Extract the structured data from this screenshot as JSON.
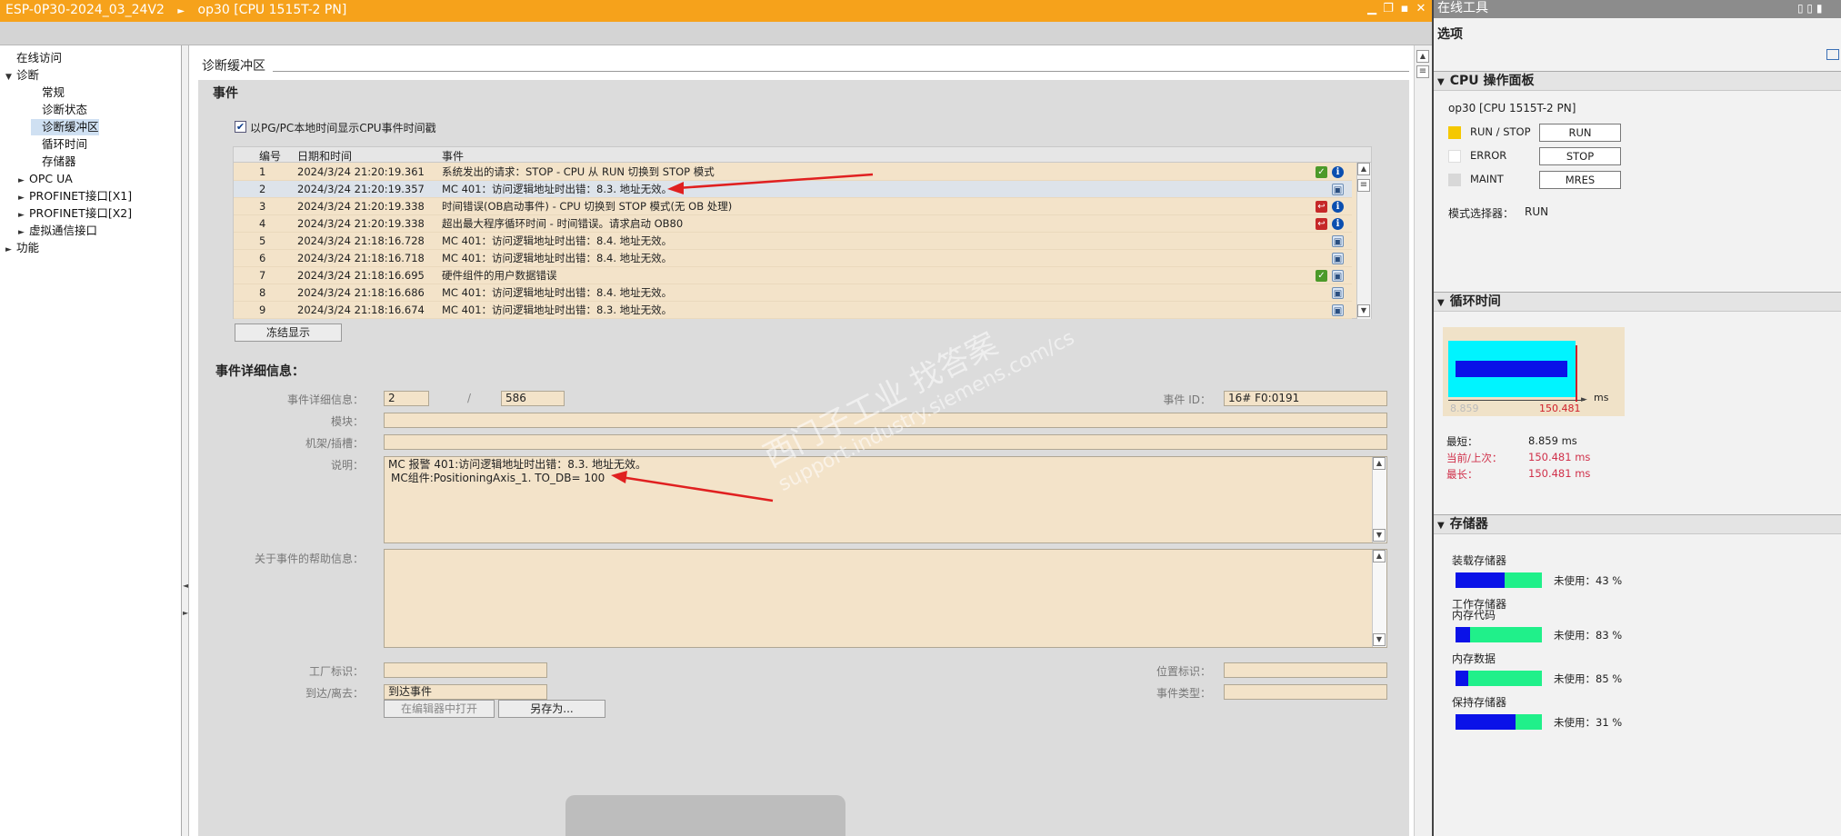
{
  "titlebar": {
    "project": "ESP-0P30-2024_03_24V2",
    "device": "op30 [CPU 1515T-2 PN]",
    "sep": "►"
  },
  "nav": {
    "items": [
      {
        "label": "在线访问",
        "indent": 0,
        "tri": ""
      },
      {
        "label": "诊断",
        "indent": 0,
        "tri": "▼"
      },
      {
        "label": "常规",
        "indent": 2,
        "tri": ""
      },
      {
        "label": "诊断状态",
        "indent": 2,
        "tri": ""
      },
      {
        "label": "诊断缓冲区",
        "indent": 2,
        "tri": "",
        "selected": true
      },
      {
        "label": "循环时间",
        "indent": 2,
        "tri": ""
      },
      {
        "label": "存储器",
        "indent": 2,
        "tri": ""
      },
      {
        "label": "OPC UA",
        "indent": 1,
        "tri": "►"
      },
      {
        "label": "PROFINET接口[X1]",
        "indent": 1,
        "tri": "►"
      },
      {
        "label": "PROFINET接口[X2]",
        "indent": 1,
        "tri": "►"
      },
      {
        "label": "虚拟通信接口",
        "indent": 1,
        "tri": "►"
      },
      {
        "label": "功能",
        "indent": 0,
        "tri": "►"
      }
    ]
  },
  "main": {
    "section_title": "诊断缓冲区",
    "events_title": "事件",
    "checkbox_label": "以PG/PC本地时间显示CPU事件时间戳",
    "columns": [
      "编号",
      "日期和时间",
      "事件"
    ],
    "rows": [
      {
        "no": "1",
        "time": "2024/3/24 21:20:19.361",
        "event": "系统发出的请求：STOP - CPU 从 RUN 切换到 STOP 模式",
        "icons": [
          "check",
          "info"
        ]
      },
      {
        "no": "2",
        "time": "2024/3/24 21:20:19.357",
        "event": "MC 401：访问逻辑地址时出错：8.3. 地址无效。",
        "icons": [
          "user"
        ],
        "selected": true
      },
      {
        "no": "3",
        "time": "2024/3/24 21:20:19.338",
        "event": "时间错误(OB启动事件) - CPU 切换到 STOP 模式(无 OB 处理)",
        "icons": [
          "error",
          "info"
        ]
      },
      {
        "no": "4",
        "time": "2024/3/24 21:20:19.338",
        "event": "超出最大程序循环时间 - 时间错误。请求启动 OB80",
        "icons": [
          "error",
          "info"
        ]
      },
      {
        "no": "5",
        "time": "2024/3/24 21:18:16.728",
        "event": "MC 401：访问逻辑地址时出错：8.4. 地址无效。",
        "icons": [
          "user"
        ]
      },
      {
        "no": "6",
        "time": "2024/3/24 21:18:16.718",
        "event": "MC 401：访问逻辑地址时出错：8.4. 地址无效。",
        "icons": [
          "user"
        ]
      },
      {
        "no": "7",
        "time": "2024/3/24 21:18:16.695",
        "event": "硬件组件的用户数据错误",
        "icons": [
          "check",
          "user"
        ]
      },
      {
        "no": "8",
        "time": "2024/3/24 21:18:16.686",
        "event": "MC 401：访问逻辑地址时出错：8.4. 地址无效。",
        "icons": [
          "user"
        ]
      },
      {
        "no": "9",
        "time": "2024/3/24 21:18:16.674",
        "event": "MC 401：访问逻辑地址时出错：8.3. 地址无效。",
        "icons": [
          "user"
        ]
      }
    ],
    "freeze_button": "冻结显示",
    "details_title": "事件详细信息：",
    "detail_label": "事件详细信息：",
    "detail_current": "2",
    "detail_slash": "/",
    "detail_total": "586",
    "event_id_label": "事件 ID：",
    "event_id": "16# F0:0191",
    "module_label": "模块：",
    "rack_label": "机架/插槽：",
    "desc_label": "说明：",
    "desc_line1": "MC 报警 401:访问逻辑地址时出错：8.3. 地址无效。",
    "desc_line2": "MC组件:PositioningAxis_1.  TO_DB=  100",
    "help_label": "关于事件的帮助信息：",
    "plant_label": "工厂标识：",
    "location_label": "位置标识：",
    "arrive_label": "到达/离去：",
    "arrive_value": "到达事件",
    "event_type_label": "事件类型：",
    "open_editor_button": "在编辑器中打开",
    "save_as_button": "另存为..."
  },
  "watermark": {
    "line1": "西门子工业  找答案",
    "line2": "support.industry.siemens.com/cs"
  },
  "right": {
    "title": "在线工具",
    "options": "选项",
    "cpu_panel_title": "CPU 操作面板",
    "cpu_name": "op30 [CPU 1515T-2 PN]",
    "leds": [
      {
        "label": "RUN / STOP",
        "color": "#f5c800",
        "button": "RUN"
      },
      {
        "label": "ERROR",
        "color": "#ffffff",
        "button": "STOP"
      },
      {
        "label": "MAINT",
        "color": "#d8d8d8",
        "button": "MRES"
      }
    ],
    "mode_label": "模式选择器：",
    "mode_value": "RUN",
    "cycle_title": "循环时间",
    "cycle": {
      "min_axis": "8.859",
      "max_axis": "150.481",
      "unit": "ms",
      "current_fraction": 0.93
    },
    "cycle_stats": [
      {
        "label": "最短：",
        "value": "8.859 ms",
        "color": "#222"
      },
      {
        "label": "当前/上次：",
        "value": "150.481 ms",
        "color": "#d0304a"
      },
      {
        "label": "最长：",
        "value": "150.481 ms",
        "color": "#d0304a"
      }
    ],
    "memory_title": "存储器",
    "memory": [
      {
        "label": "装载存储器",
        "free": "未使用：43 %",
        "used_fraction": 0.57
      },
      {
        "label": "工作存储器",
        "label2": "内存代码",
        "free": "未使用：83 %",
        "used_fraction": 0.17
      },
      {
        "label": "内存数据",
        "free": "未使用：85 %",
        "used_fraction": 0.15
      },
      {
        "label": "保持存储器",
        "free": "未使用：31 %",
        "used_fraction": 0.69
      }
    ]
  }
}
